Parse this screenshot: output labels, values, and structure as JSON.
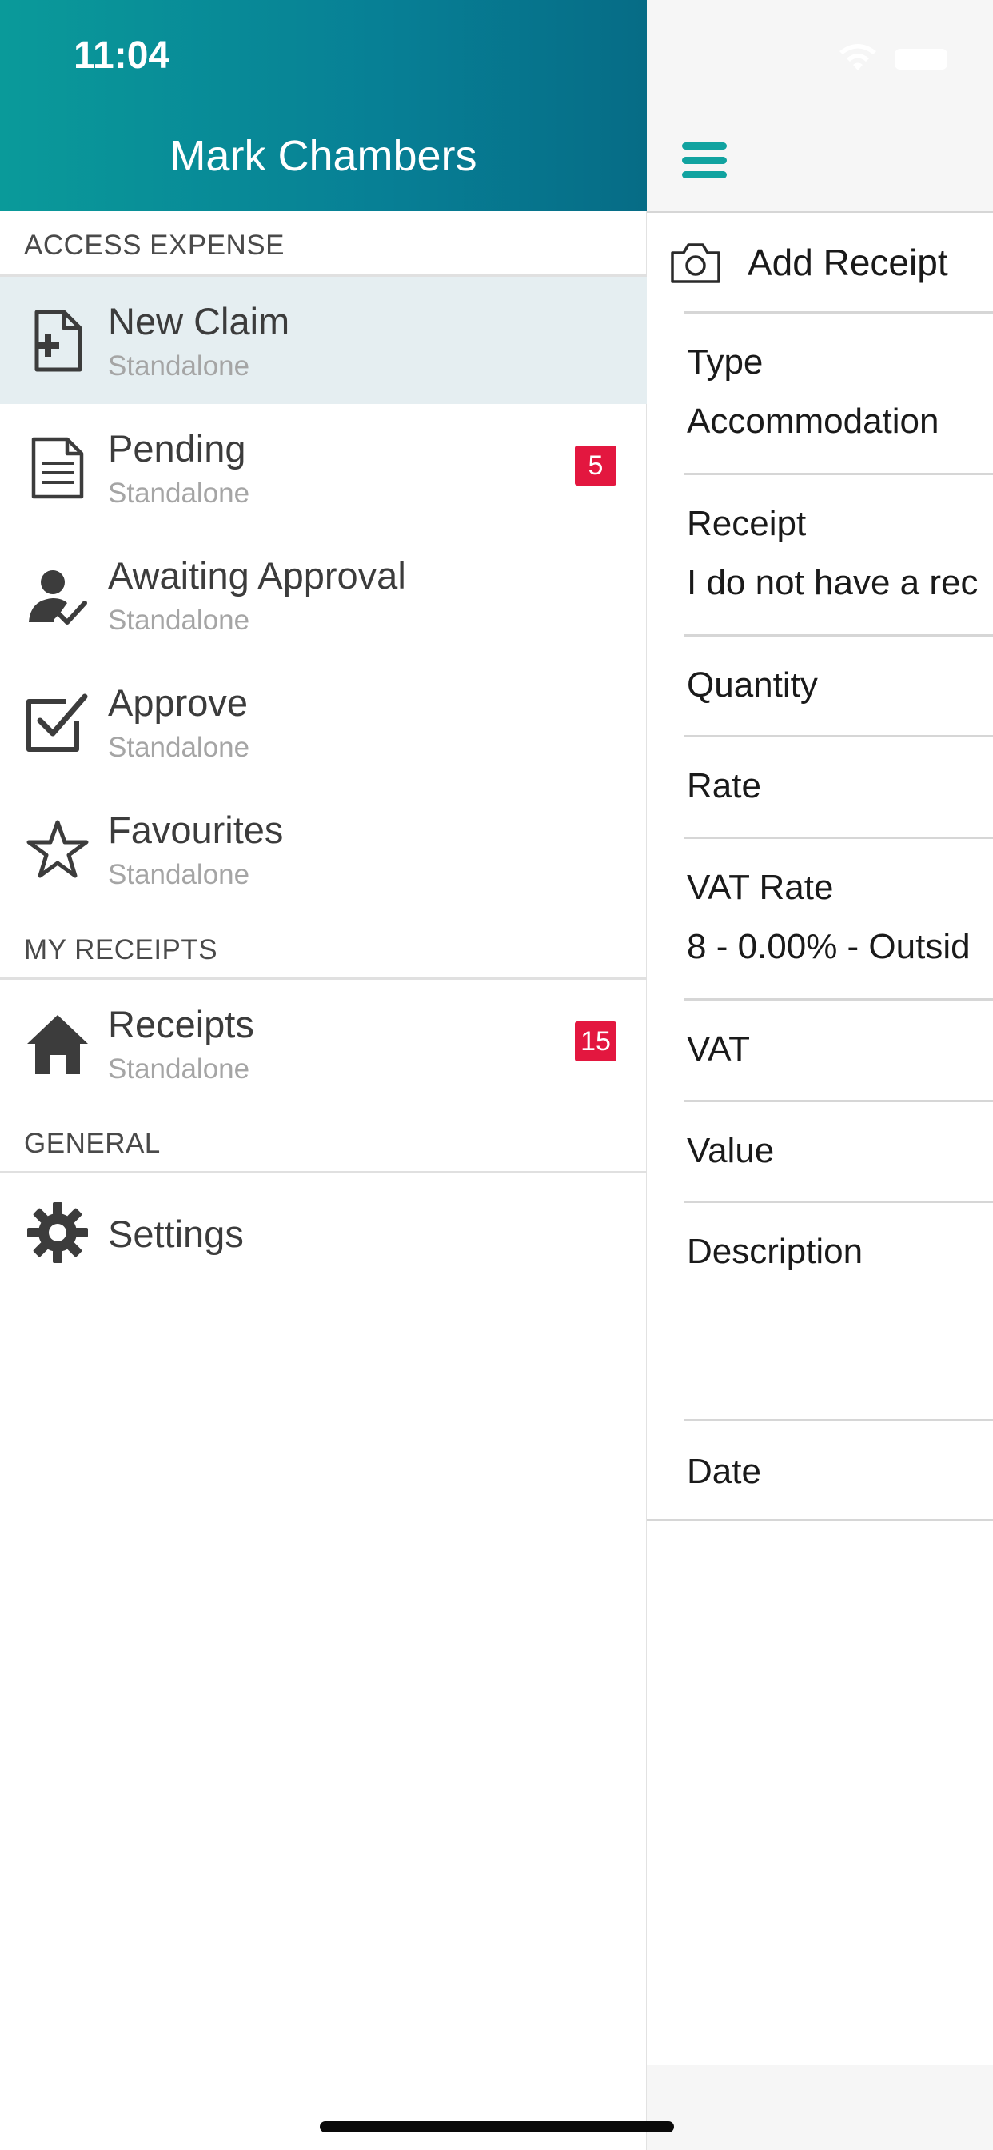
{
  "status_bar": {
    "time": "11:04"
  },
  "drawer": {
    "user_name": "Mark Chambers",
    "sections": [
      {
        "title": "ACCESS EXPENSE"
      },
      {
        "title": "MY RECEIPTS"
      },
      {
        "title": "GENERAL"
      }
    ],
    "items": [
      {
        "label": "New Claim",
        "sub": "Standalone",
        "icon": "new-claim-icon",
        "selected": true
      },
      {
        "label": "Pending",
        "sub": "Standalone",
        "icon": "document-icon",
        "badge": "5"
      },
      {
        "label": "Awaiting Approval",
        "sub": "Standalone",
        "icon": "person-check-icon"
      },
      {
        "label": "Approve",
        "sub": "Standalone",
        "icon": "checkbox-icon"
      },
      {
        "label": "Favourites",
        "sub": "Standalone",
        "icon": "star-icon"
      },
      {
        "label": "Receipts",
        "sub": "Standalone",
        "icon": "home-icon",
        "badge": "15"
      },
      {
        "label": "Settings",
        "icon": "gear-icon"
      }
    ]
  },
  "form": {
    "add_receipt_label": "Add Receipt",
    "fields": [
      {
        "label": "Type",
        "value": "Accommodation"
      },
      {
        "label": "Receipt",
        "value": "I do not have a rec"
      },
      {
        "label": "Quantity"
      },
      {
        "label": "Rate"
      },
      {
        "label": "VAT Rate",
        "value": "8 - 0.00% - Outsid"
      },
      {
        "label": "VAT"
      },
      {
        "label": "Value"
      },
      {
        "label": "Description"
      },
      {
        "label": "Date"
      }
    ]
  },
  "colors": {
    "header_gradient_start": "#0a9a9a",
    "header_gradient_end": "#066c86",
    "accent": "#11a3a0",
    "badge": "#e3173f",
    "selected_row": "#e5eef1"
  }
}
